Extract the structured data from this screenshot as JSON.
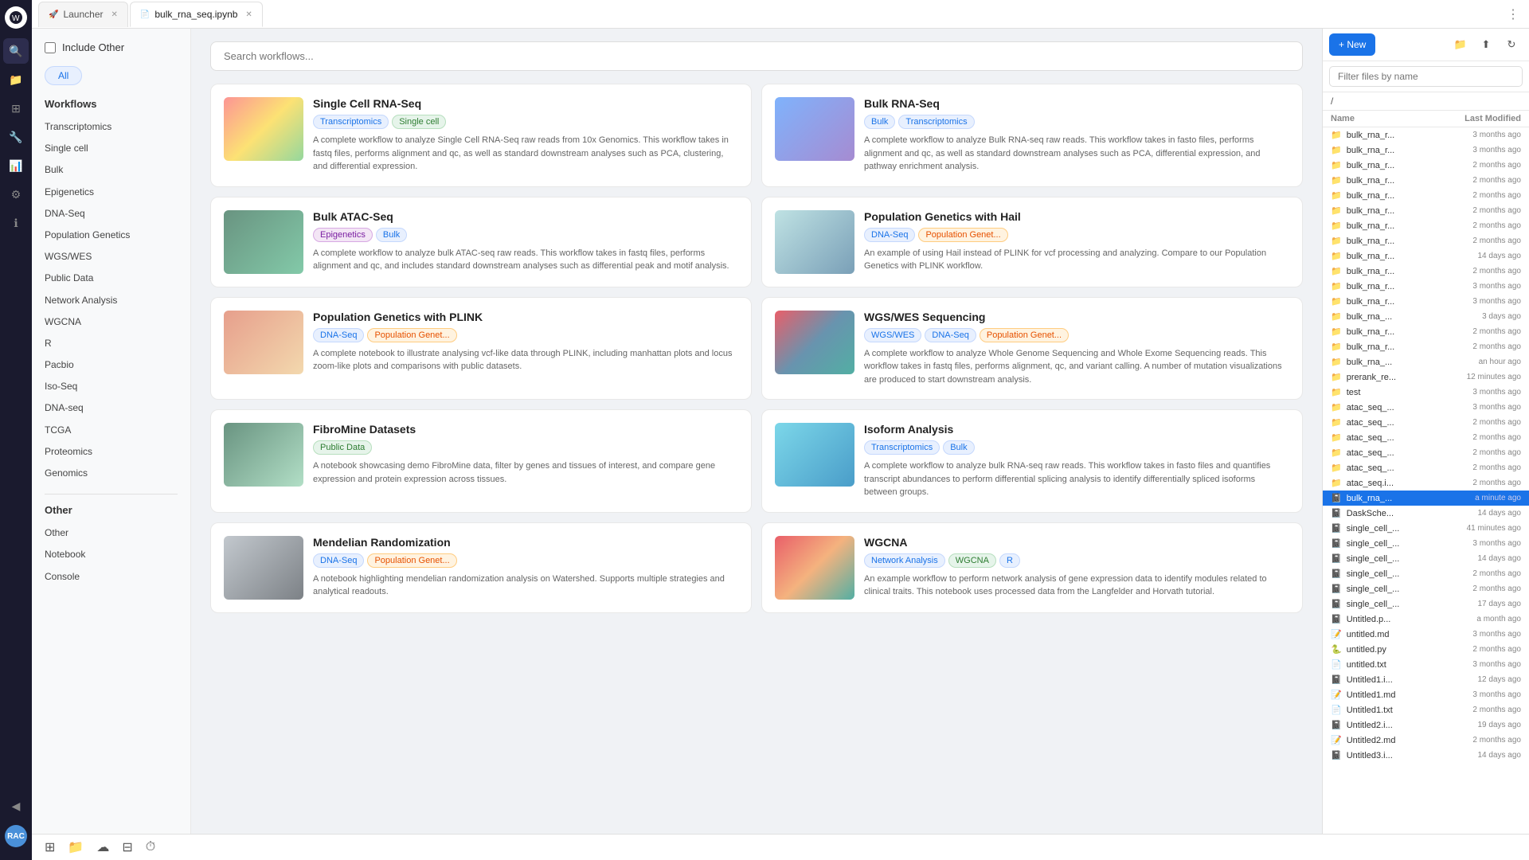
{
  "tabs": [
    {
      "id": "launcher",
      "label": "Launcher",
      "icon": "🚀",
      "active": false,
      "closable": true
    },
    {
      "id": "notebook",
      "label": "bulk_rna_seq.ipynb",
      "icon": "📄",
      "active": true,
      "closable": true
    }
  ],
  "search": {
    "placeholder": "Search workflows..."
  },
  "filter": {
    "include_other_label": "Include Other",
    "all_label": "All",
    "workflows_section": "Workflows",
    "other_section": "Other",
    "other_subsection": "Other",
    "items": [
      "Transcriptomics",
      "Single cell",
      "Bulk",
      "Epigenetics",
      "DNA-Seq",
      "Population Genetics",
      "WGS/WES",
      "Public Data",
      "Network Analysis",
      "WGCNA",
      "R",
      "Pacbio",
      "Iso-Seq",
      "DNA-seq",
      "TCGA",
      "Proteomics",
      "Genomics"
    ],
    "other_items": [
      "Other",
      "Notebook",
      "Console"
    ]
  },
  "workflows": [
    {
      "id": "scrna",
      "title": "Single Cell RNA-Seq",
      "tags": [
        {
          "label": "Transcriptomics",
          "style": "blue"
        },
        {
          "label": "Single cell",
          "style": "green"
        }
      ],
      "description": "A complete workflow to analyze Single Cell RNA-Seq raw reads from 10x Genomics. This workflow takes in fastq files, performs alignment and qc, as well as standard downstream analyses such as PCA, clustering, and differential expression.",
      "img": "img-scrna"
    },
    {
      "id": "bulk-rna",
      "title": "Bulk RNA-Seq",
      "tags": [
        {
          "label": "Bulk",
          "style": "blue"
        },
        {
          "label": "Transcriptomics",
          "style": "blue"
        }
      ],
      "description": "A complete workflow to analyze Bulk RNA-seq raw reads. This workflow takes in fasto files, performs alignment and qc, as well as standard downstream analyses such as PCA, differential expression, and pathway enrichment analysis.",
      "img": "img-bulk"
    },
    {
      "id": "bulk-atac",
      "title": "Bulk ATAC-Seq",
      "tags": [
        {
          "label": "Epigenetics",
          "style": "purple"
        },
        {
          "label": "Bulk",
          "style": "blue"
        }
      ],
      "description": "A complete workflow to analyze bulk ATAC-seq raw reads. This workflow takes in fastq files, performs alignment and qc, and includes standard downstream analyses such as differential peak and motif analysis.",
      "img": "img-atac"
    },
    {
      "id": "popgen-hail",
      "title": "Population Genetics with Hail",
      "tags": [
        {
          "label": "DNA-Seq",
          "style": "blue"
        },
        {
          "label": "Population Genet...",
          "style": "orange"
        }
      ],
      "description": "An example of using Hail instead of PLINK for vcf processing and analyzing. Compare to our Population Genetics with PLINK workflow.",
      "img": "img-popgen-hail"
    },
    {
      "id": "popgen-plink",
      "title": "Population Genetics with PLINK",
      "tags": [
        {
          "label": "DNA-Seq",
          "style": "blue"
        },
        {
          "label": "Population Genet...",
          "style": "orange"
        }
      ],
      "description": "A complete notebook to illustrate analysing vcf-like data through PLINK, including manhattan plots and locus zoom-like plots and comparisons with public datasets.",
      "img": "img-popgen-plink"
    },
    {
      "id": "wgs",
      "title": "WGS/WES Sequencing",
      "tags": [
        {
          "label": "WGS/WES",
          "style": "blue"
        },
        {
          "label": "DNA-Seq",
          "style": "blue"
        },
        {
          "label": "Population Genet...",
          "style": "orange"
        }
      ],
      "description": "A complete workflow to analyze Whole Genome Sequencing and Whole Exome Sequencing reads. This workflow takes in fastq files, performs alignment, qc, and variant calling. A number of mutation visualizations are produced to start downstream analysis.",
      "img": "img-wgs"
    },
    {
      "id": "fibro",
      "title": "FibroMine Datasets",
      "tags": [
        {
          "label": "Public Data",
          "style": "green"
        }
      ],
      "description": "A notebook showcasing demo FibroMine data, filter by genes and tissues of interest, and compare gene expression and protein expression across tissues.",
      "img": "img-fibro"
    },
    {
      "id": "isoform",
      "title": "Isoform Analysis",
      "tags": [
        {
          "label": "Transcriptomics",
          "style": "blue"
        },
        {
          "label": "Bulk",
          "style": "blue"
        }
      ],
      "description": "A complete workflow to analyze bulk RNA-seq raw reads. This workflow takes in fasto files and quantifies transcript abundances to perform differential splicing analysis to identify differentially spliced isoforms between groups.",
      "img": "img-isoform"
    },
    {
      "id": "mendelian",
      "title": "Mendelian Randomization",
      "tags": [
        {
          "label": "DNA-Seq",
          "style": "blue"
        },
        {
          "label": "Population Genet...",
          "style": "orange"
        }
      ],
      "description": "A notebook highlighting mendelian randomization analysis on Watershed. Supports multiple strategies and analytical readouts.",
      "img": "img-mendelian"
    },
    {
      "id": "wgcna",
      "title": "WGCNA",
      "tags": [
        {
          "label": "Network Analysis",
          "style": "blue"
        },
        {
          "label": "WGCNA",
          "style": "green"
        },
        {
          "label": "R",
          "style": "blue"
        }
      ],
      "description": "An example workflow to perform network analysis of gene expression data to identify modules related to clinical traits. This notebook uses processed data from the Langfelder and Horvath tutorial.",
      "img": "img-wgcna"
    }
  ],
  "files": {
    "filter_placeholder": "Filter files by name",
    "path": "/",
    "col_name": "Name",
    "col_date": "Last Modified",
    "items": [
      {
        "name": "bulk_rna_r...",
        "date": "3 months ago",
        "type": "folder",
        "active": false
      },
      {
        "name": "bulk_rna_r...",
        "date": "3 months ago",
        "type": "folder",
        "active": false
      },
      {
        "name": "bulk_rna_r...",
        "date": "2 months ago",
        "type": "folder",
        "active": false
      },
      {
        "name": "bulk_rna_r...",
        "date": "2 months ago",
        "type": "folder",
        "active": false
      },
      {
        "name": "bulk_rna_r...",
        "date": "2 months ago",
        "type": "folder",
        "active": false
      },
      {
        "name": "bulk_rna_r...",
        "date": "2 months ago",
        "type": "folder",
        "active": false
      },
      {
        "name": "bulk_rna_r...",
        "date": "2 months ago",
        "type": "folder",
        "active": false
      },
      {
        "name": "bulk_rna_r...",
        "date": "2 months ago",
        "type": "folder",
        "active": false
      },
      {
        "name": "bulk_rna_r...",
        "date": "14 days ago",
        "type": "folder",
        "active": false
      },
      {
        "name": "bulk_rna_r...",
        "date": "2 months ago",
        "type": "folder",
        "active": false
      },
      {
        "name": "bulk_rna_r...",
        "date": "3 months ago",
        "type": "folder",
        "active": false
      },
      {
        "name": "bulk_rna_r...",
        "date": "3 months ago",
        "type": "folder",
        "active": false
      },
      {
        "name": "bulk_rna_...",
        "date": "3 days ago",
        "type": "folder",
        "active": false
      },
      {
        "name": "bulk_rna_r...",
        "date": "2 months ago",
        "type": "folder",
        "active": false
      },
      {
        "name": "bulk_rna_r...",
        "date": "2 months ago",
        "type": "folder",
        "active": false
      },
      {
        "name": "bulk_rna_...",
        "date": "an hour ago",
        "type": "folder",
        "active": false
      },
      {
        "name": "prerank_re...",
        "date": "12 minutes ago",
        "type": "folder",
        "active": false
      },
      {
        "name": "test",
        "date": "3 months ago",
        "type": "folder",
        "active": false
      },
      {
        "name": "atac_seq_...",
        "date": "3 months ago",
        "type": "folder",
        "active": false
      },
      {
        "name": "atac_seq_...",
        "date": "2 months ago",
        "type": "folder",
        "active": false
      },
      {
        "name": "atac_seq_...",
        "date": "2 months ago",
        "type": "folder",
        "active": false
      },
      {
        "name": "atac_seq_...",
        "date": "2 months ago",
        "type": "folder",
        "active": false
      },
      {
        "name": "atac_seq_...",
        "date": "2 months ago",
        "type": "folder",
        "active": false
      },
      {
        "name": "atac_seq.i...",
        "date": "2 months ago",
        "type": "folder",
        "active": false
      },
      {
        "name": "bulk_rna_...",
        "date": "a minute ago",
        "type": "notebook",
        "active": true
      },
      {
        "name": "DaskSche...",
        "date": "14 days ago",
        "type": "notebook",
        "active": false
      },
      {
        "name": "single_cell_...",
        "date": "41 minutes ago",
        "type": "notebook",
        "active": false
      },
      {
        "name": "single_cell_...",
        "date": "3 months ago",
        "type": "notebook",
        "active": false
      },
      {
        "name": "single_cell_...",
        "date": "14 days ago",
        "type": "notebook",
        "active": false
      },
      {
        "name": "single_cell_...",
        "date": "2 months ago",
        "type": "notebook",
        "active": false
      },
      {
        "name": "single_cell_...",
        "date": "2 months ago",
        "type": "notebook",
        "active": false
      },
      {
        "name": "single_cell_...",
        "date": "17 days ago",
        "type": "notebook",
        "active": false
      },
      {
        "name": "Untitled.p...",
        "date": "a month ago",
        "type": "notebook",
        "active": false
      },
      {
        "name": "untitled.md",
        "date": "3 months ago",
        "type": "md",
        "active": false
      },
      {
        "name": "untitled.py",
        "date": "2 months ago",
        "type": "python",
        "active": false
      },
      {
        "name": "untitled.txt",
        "date": "3 months ago",
        "type": "txt",
        "active": false
      },
      {
        "name": "Untitled1.i...",
        "date": "12 days ago",
        "type": "notebook",
        "active": false
      },
      {
        "name": "Untitled1.md",
        "date": "3 months ago",
        "type": "md",
        "active": false
      },
      {
        "name": "Untitled1.txt",
        "date": "2 months ago",
        "type": "txt",
        "active": false
      },
      {
        "name": "Untitled2.i...",
        "date": "19 days ago",
        "type": "notebook",
        "active": false
      },
      {
        "name": "Untitled2.md",
        "date": "2 months ago",
        "type": "md",
        "active": false
      },
      {
        "name": "Untitled3.i...",
        "date": "14 days ago",
        "type": "notebook",
        "active": false
      }
    ]
  },
  "bottom_tools": [
    "grid-icon",
    "folder-icon",
    "cloud-icon",
    "settings-icon",
    "clock-icon"
  ],
  "new_button_label": "+ New",
  "notification_dot": true
}
